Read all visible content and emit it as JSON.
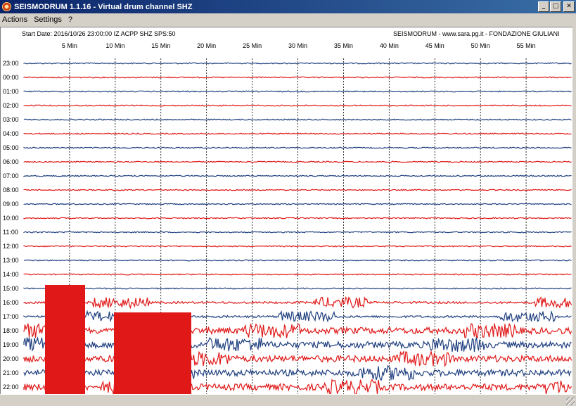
{
  "window": {
    "title": "SEISMODRUM 1.1.16 - Virtual drum channel SHZ"
  },
  "menu": {
    "items": [
      "Actions",
      "Settings",
      "?"
    ]
  },
  "header": {
    "left": "Start Date: 2016/10/26 23:00:00 IZ ACPP SHZ SPS:50",
    "right": "SEISMODRUM - www.sara.pg.it - FONDAZIONE GIULIANI"
  },
  "minute_labels": [
    "5 Min",
    "10 Min",
    "15 Min",
    "20 Min",
    "25 Min",
    "30 Min",
    "35 Min",
    "40 Min",
    "45 Min",
    "50 Min",
    "55 Min"
  ],
  "hour_labels": [
    "23:00",
    "00:00",
    "01:00",
    "02:00",
    "03:00",
    "04:00",
    "05:00",
    "06:00",
    "07:00",
    "08:00",
    "09:00",
    "10:00",
    "11:00",
    "12:00",
    "13:00",
    "14:00",
    "15:00",
    "16:00",
    "17:00",
    "18:00",
    "19:00",
    "20:00",
    "21:00",
    "22:00"
  ],
  "colors": {
    "trace_a": "#1f3f7f",
    "trace_b": "#e01818",
    "grid": "#000000",
    "title_bar": "#0a246a"
  }
}
